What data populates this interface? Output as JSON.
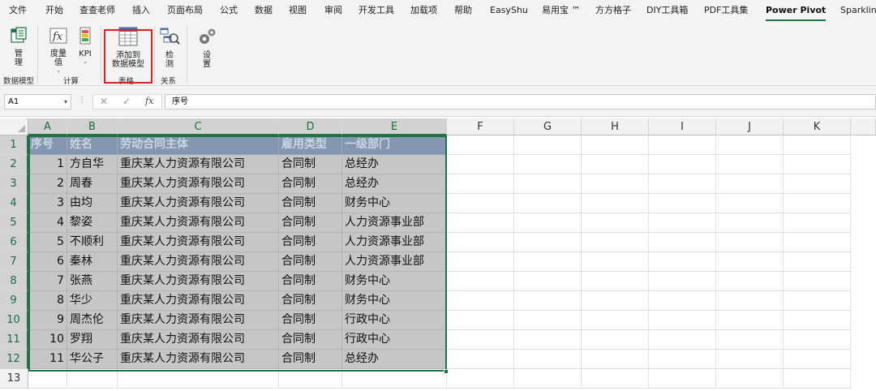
{
  "menu_tabs": [
    "文件",
    "开始",
    "查查老师",
    "插入",
    "页面布局",
    "公式",
    "数据",
    "视图",
    "审阅",
    "开发工具",
    "加载项",
    "帮助",
    "EasyShu",
    "易用宝 ™",
    "方方格子",
    "DIY工具箱",
    "PDF工具集",
    "Power Pivot",
    "Sparkline"
  ],
  "active_tab": "Power Pivot",
  "ribbon": {
    "manage_label": "管\n理",
    "measures_label": "度量\n值",
    "kpi_label": "KPI",
    "add_to_model_label": "添加到\n数据模型",
    "detect_label": "检\n测",
    "settings_label": "设\n置",
    "groups": [
      "数据模型",
      "计算",
      "表格",
      "关系"
    ]
  },
  "formula_bar": {
    "name_box": "A1",
    "formula": "序号",
    "fx_symbol": "fx",
    "cancel_symbol": "✕",
    "enter_symbol": "✓"
  },
  "grid": {
    "columns": [
      "A",
      "B",
      "C",
      "D",
      "E",
      "F",
      "G",
      "H",
      "I",
      "J",
      "K"
    ],
    "rows": [
      "1",
      "2",
      "3",
      "4",
      "5",
      "6",
      "7",
      "8",
      "9",
      "10",
      "11",
      "12",
      "13"
    ],
    "header": [
      "序号",
      "姓名",
      "劳动合同主体",
      "雇用类型",
      "一级部门"
    ],
    "data": [
      [
        "1",
        "方自华",
        "重庆某人力资源有限公司",
        "合同制",
        "总经办"
      ],
      [
        "2",
        "周春",
        "重庆某人力资源有限公司",
        "合同制",
        "总经办"
      ],
      [
        "3",
        "由均",
        "重庆某人力资源有限公司",
        "合同制",
        "财务中心"
      ],
      [
        "4",
        "黎姿",
        "重庆某人力资源有限公司",
        "合同制",
        "人力资源事业部"
      ],
      [
        "5",
        "不顺利",
        "重庆某人力资源有限公司",
        "合同制",
        "人力资源事业部"
      ],
      [
        "6",
        "秦林",
        "重庆某人力资源有限公司",
        "合同制",
        "人力资源事业部"
      ],
      [
        "7",
        "张燕",
        "重庆某人力资源有限公司",
        "合同制",
        "财务中心"
      ],
      [
        "8",
        "华少",
        "重庆某人力资源有限公司",
        "合同制",
        "财务中心"
      ],
      [
        "9",
        "周杰伦",
        "重庆某人力资源有限公司",
        "合同制",
        "行政中心"
      ],
      [
        "10",
        "罗翔",
        "重庆某人力资源有限公司",
        "合同制",
        "行政中心"
      ],
      [
        "11",
        "华公子",
        "重庆某人力资源有限公司",
        "合同制",
        "总经办"
      ]
    ]
  },
  "colors": {
    "accent": "#217346",
    "header_fill": "#8496b0",
    "selection_fill": "#c6c6c6",
    "highlight_box": "#e02020"
  }
}
